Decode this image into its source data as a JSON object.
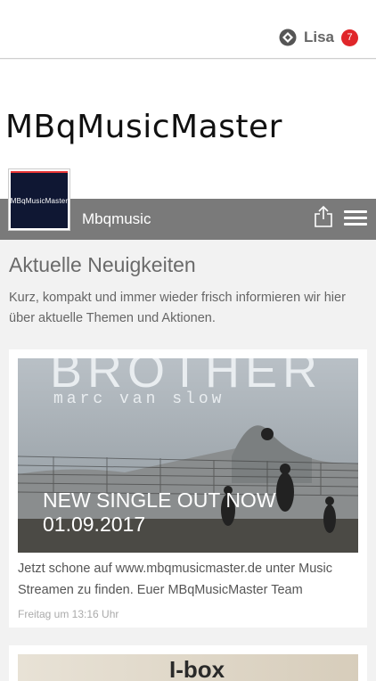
{
  "header": {
    "user_name": "Lisa",
    "notification_count": "7",
    "user_icon": "app-logo-icon"
  },
  "brand": {
    "logo_text": "MBqMusicMaster",
    "thumb_text": "MBqMusicMaster"
  },
  "titlebar": {
    "title": "Mbqmusic",
    "share_icon": "share-icon",
    "menu_icon": "menu-icon"
  },
  "main": {
    "heading": "Aktuelle Neuigkeiten",
    "intro": "Kurz, kompakt und immer wieder frisch informieren wir hier über aktuelle Themen und Aktionen."
  },
  "posts": [
    {
      "image_title_line1": "BROTHER",
      "image_subtitle": "marc van slow",
      "title": "NEW SINGLE OUT NOW 01.09.2017",
      "text": "Jetzt schone auf www.mbqmusicmaster.de unter Music Streamen zu finden. Euer MBqMusicMaster Team",
      "time": "Freitag um 13:16 Uhr"
    },
    {
      "image_word": "I-box"
    }
  ]
}
